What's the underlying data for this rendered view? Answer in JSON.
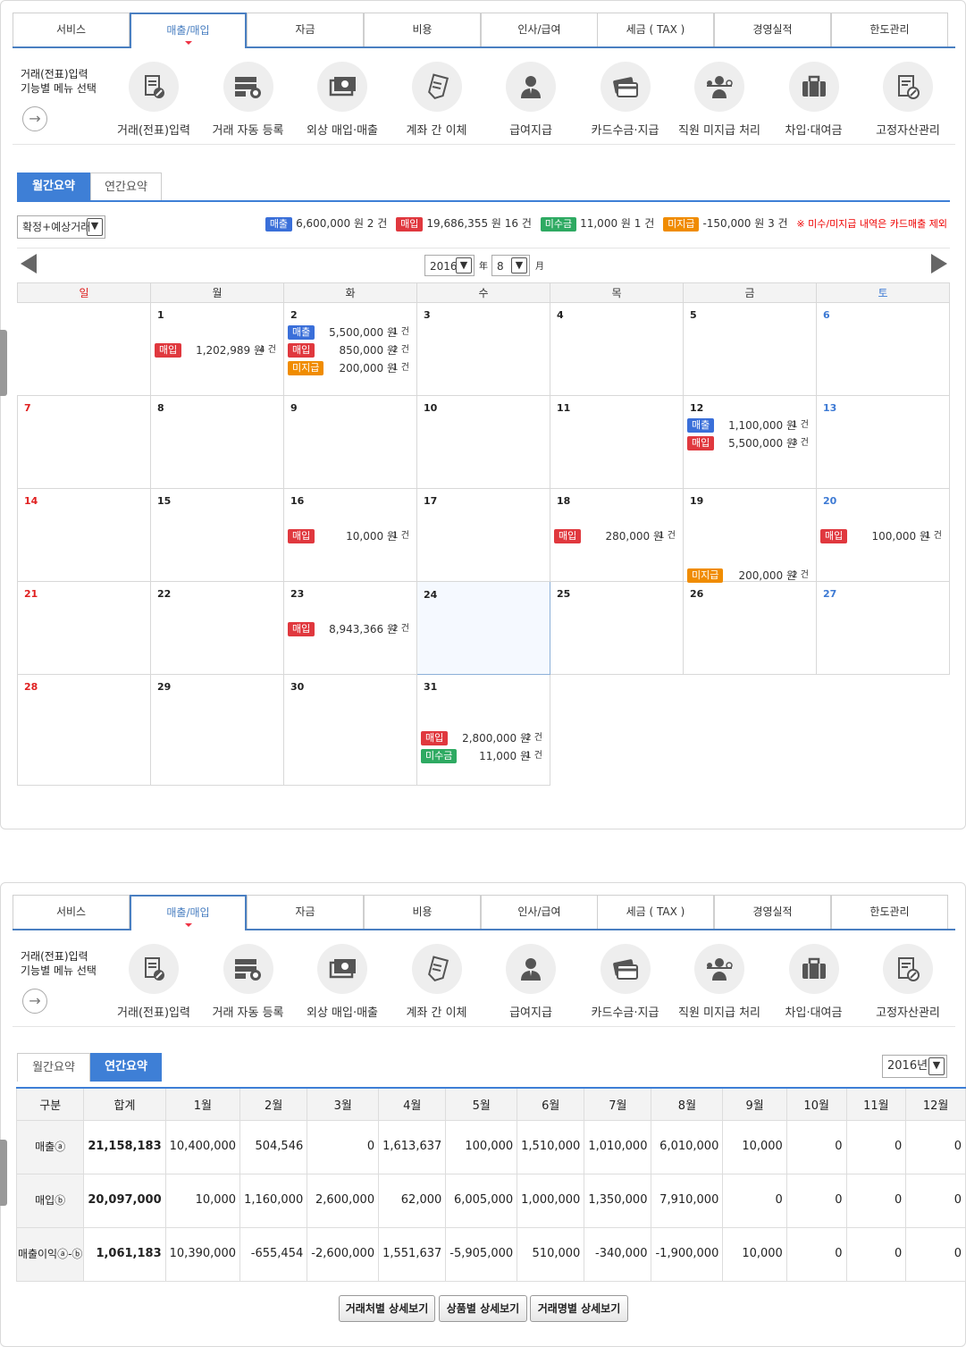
{
  "nav": {
    "tabs": [
      "서비스",
      "매출/매입",
      "자금",
      "비용",
      "인사/급여",
      "세금 ( TAX )",
      "경영실적",
      "한도관리"
    ],
    "active_index": 1
  },
  "menu": {
    "hint_line1": "거래(전표)입력",
    "hint_line2": "기능별 메뉴 선택",
    "items": [
      {
        "label": "거래(전표)입력",
        "icon": "document-pen-icon"
      },
      {
        "label": "거래 자동 등록",
        "icon": "server-sync-icon"
      },
      {
        "label": "외상 매입·매출",
        "icon": "money-exchange-icon"
      },
      {
        "label": "계좌 간 이체",
        "icon": "transfer-receipt-icon"
      },
      {
        "label": "급여지급",
        "icon": "person-suit-icon"
      },
      {
        "label": "카드수금·지급",
        "icon": "credit-card-icon"
      },
      {
        "label": "직원 미지급 처리",
        "icon": "employee-balance-icon"
      },
      {
        "label": "차입·대여금",
        "icon": "briefcase-icon"
      },
      {
        "label": "고정자산관리",
        "icon": "asset-document-icon"
      }
    ]
  },
  "monthly": {
    "tab_monthly": "월간요약",
    "tab_yearly": "연간요약",
    "filter_value": "확정+예상거래",
    "summary": {
      "sale_label": "매출",
      "sale_text": "6,600,000 원 2 건",
      "buy_label": "매입",
      "buy_text": "19,686,355 원 16 건",
      "recv_label": "미수금",
      "recv_text": "11,000 원 1 건",
      "pay_label": "미지급",
      "pay_text": "-150,000 원 3 건",
      "note": "※ 미수/미지급 내역은 카드매출 제외"
    },
    "year": "2016",
    "year_unit": "年",
    "month": "8",
    "month_unit": "月",
    "weekdays": [
      "일",
      "월",
      "화",
      "수",
      "목",
      "금",
      "토"
    ],
    "today": 24,
    "days": [
      [
        null,
        {
          "d": "1",
          "e": [
            {
              "t": "buy",
              "l": "매입",
              "a": "1,202,989 원",
              "c": "4 건",
              "slot": 2
            }
          ]
        },
        {
          "d": "2",
          "e": [
            {
              "t": "sale",
              "l": "매출",
              "a": "5,500,000 원",
              "c": "1 건",
              "slot": 1
            },
            {
              "t": "buy",
              "l": "매입",
              "a": "850,000 원",
              "c": "2 건",
              "slot": 2
            },
            {
              "t": "pay",
              "l": "미지급",
              "a": "200,000 원",
              "c": "1 건",
              "slot": 3
            }
          ]
        },
        {
          "d": "3",
          "e": []
        },
        {
          "d": "4",
          "e": []
        },
        {
          "d": "5",
          "e": []
        },
        {
          "d": "6",
          "e": []
        }
      ],
      [
        {
          "d": "7",
          "e": []
        },
        {
          "d": "8",
          "e": []
        },
        {
          "d": "9",
          "e": []
        },
        {
          "d": "10",
          "e": []
        },
        {
          "d": "11",
          "e": []
        },
        {
          "d": "12",
          "e": [
            {
              "t": "sale",
              "l": "매출",
              "a": "1,100,000 원",
              "c": "1 건",
              "slot": 1
            },
            {
              "t": "buy",
              "l": "매입",
              "a": "5,500,000 원",
              "c": "3 건",
              "slot": 2
            }
          ]
        },
        {
          "d": "13",
          "e": []
        }
      ],
      [
        {
          "d": "14",
          "e": []
        },
        {
          "d": "15",
          "e": []
        },
        {
          "d": "16",
          "e": [
            {
              "t": "buy",
              "l": "매입",
              "a": "10,000 원",
              "c": "1 건",
              "slot": 2
            }
          ]
        },
        {
          "d": "17",
          "e": []
        },
        {
          "d": "18",
          "e": [
            {
              "t": "buy",
              "l": "매입",
              "a": "280,000 원",
              "c": "1 건",
              "slot": 2
            }
          ]
        },
        {
          "d": "19",
          "e": [
            {
              "t": "pay",
              "l": "미지급",
              "a": "200,000 원",
              "c": "2 건",
              "slot": 4
            }
          ]
        },
        {
          "d": "20",
          "e": [
            {
              "t": "buy",
              "l": "매입",
              "a": "100,000 원",
              "c": "1 건",
              "slot": 2
            }
          ]
        }
      ],
      [
        {
          "d": "21",
          "e": []
        },
        {
          "d": "22",
          "e": []
        },
        {
          "d": "23",
          "e": [
            {
              "t": "buy",
              "l": "매입",
              "a": "8,943,366 원",
              "c": "2 건",
              "slot": 2
            }
          ]
        },
        {
          "d": "24",
          "e": []
        },
        {
          "d": "25",
          "e": []
        },
        {
          "d": "26",
          "e": []
        },
        {
          "d": "27",
          "e": []
        }
      ],
      [
        {
          "d": "28",
          "e": []
        },
        {
          "d": "29",
          "e": []
        },
        {
          "d": "30",
          "e": []
        },
        {
          "d": "31",
          "e": [
            {
              "t": "buy",
              "l": "매입",
              "a": "2,800,000 원",
              "c": "2 건",
              "slot": 2
            },
            {
              "t": "recv",
              "l": "미수금",
              "a": "11,000 원",
              "c": "1 건",
              "slot": 3
            }
          ]
        },
        null,
        null,
        null
      ]
    ]
  },
  "yearly": {
    "tab_monthly": "월간요약",
    "tab_yearly": "연간요약",
    "year_select": "2016년",
    "headers": [
      "구분",
      "합계",
      "1월",
      "2월",
      "3월",
      "4월",
      "5월",
      "6월",
      "7월",
      "8월",
      "9월",
      "10월",
      "11월",
      "12월"
    ],
    "rows": [
      {
        "label": "매출ⓐ",
        "total": "21,158,183",
        "values": [
          "10,400,000",
          "504,546",
          "0",
          "1,613,637",
          "100,000",
          "1,510,000",
          "1,010,000",
          "6,010,000",
          "10,000",
          "0",
          "0",
          "0"
        ]
      },
      {
        "label": "매입ⓑ",
        "total": "20,097,000",
        "values": [
          "10,000",
          "1,160,000",
          "2,600,000",
          "62,000",
          "6,005,000",
          "1,000,000",
          "1,350,000",
          "7,910,000",
          "0",
          "0",
          "0",
          "0"
        ]
      },
      {
        "label": "매출이익ⓐ-ⓑ",
        "total": "1,061,183",
        "values": [
          "10,390,000",
          "-655,454",
          "-2,600,000",
          "1,551,637",
          "-5,905,000",
          "510,000",
          "-340,000",
          "-1,900,000",
          "10,000",
          "0",
          "0",
          "0"
        ]
      }
    ],
    "buttons": [
      "거래처별 상세보기",
      "상품별 상세보기",
      "거래명별 상세보기"
    ]
  },
  "colors": {
    "sale": "#3a6fd9",
    "buy": "#e0383e",
    "recv": "#2eaa62",
    "pay": "#f08c00",
    "accent": "#3e7fd6"
  }
}
